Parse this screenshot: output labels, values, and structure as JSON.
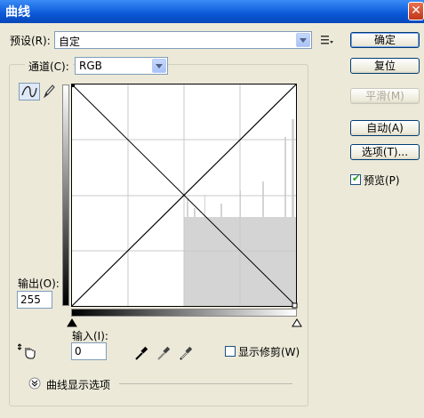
{
  "window": {
    "title": "曲线",
    "close_label": "✕"
  },
  "preset": {
    "label": "预设(R):",
    "value": "自定"
  },
  "channel": {
    "label": "通道(C):",
    "value": "RGB"
  },
  "buttons": {
    "ok": "确定",
    "reset": "复位",
    "smooth": "平滑(M)",
    "auto": "自动(A)",
    "options": "选项(T)..."
  },
  "preview": {
    "label": "预览(P)",
    "checked": true
  },
  "output": {
    "label": "输出(O):",
    "value": "255"
  },
  "input": {
    "label": "输入(I):",
    "value": "0"
  },
  "show_clipping": {
    "label": "显示修剪(W)",
    "checked": false
  },
  "curve_display_options": {
    "label": "曲线显示选项"
  },
  "icons": [
    "close-icon",
    "preset-menu-icon",
    "curve-tool-icon",
    "pencil-tool-icon",
    "hand-adjust-icon",
    "black-eyedropper-icon",
    "gray-eyedropper-icon",
    "white-eyedropper-icon",
    "expand-chevron-icon",
    "dropdown-arrow-icon"
  ],
  "colors": {
    "title_bar": "#0a58d8",
    "face": "#ece9d8",
    "histogram": "#d4d4d4",
    "grid": "#c8c8c8"
  }
}
